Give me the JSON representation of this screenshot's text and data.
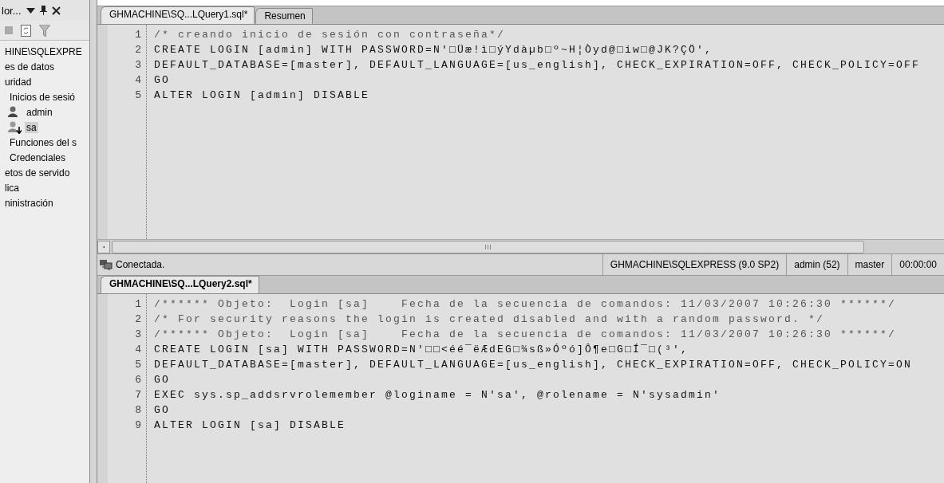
{
  "explorer": {
    "title": "lor...",
    "tree": [
      {
        "label": "HINE\\SQLEXPRE",
        "kind": "node",
        "selected": false,
        "children": [
          {
            "label": "es de datos",
            "kind": "node",
            "selected": false
          },
          {
            "label": "uridad",
            "kind": "node",
            "selected": false,
            "children": [
              {
                "label": "Inicios de sesió",
                "kind": "node",
                "selected": false,
                "children": [
                  {
                    "label": "admin",
                    "kind": "login",
                    "disabled": false,
                    "selected": false
                  },
                  {
                    "label": "sa",
                    "kind": "login",
                    "disabled": true,
                    "selected": true
                  }
                ]
              },
              {
                "label": "Funciones del s",
                "kind": "node",
                "selected": false
              },
              {
                "label": "Credenciales",
                "kind": "node",
                "selected": false
              }
            ]
          },
          {
            "label": "etos de servido",
            "kind": "node",
            "selected": false
          },
          {
            "label": "lica",
            "kind": "node",
            "selected": false
          },
          {
            "label": "ninistración",
            "kind": "node",
            "selected": false
          }
        ]
      }
    ]
  },
  "editors": [
    {
      "tabs": [
        {
          "label": "GHMACHINE\\SQ...LQuery1.sql*",
          "selected": true
        },
        {
          "label": "Resumen",
          "selected": false
        }
      ],
      "lines": [
        {
          "number": "1",
          "kind": "comment",
          "text": "/* creando inicio de sesión con contraseña*/"
        },
        {
          "number": "2",
          "kind": "code",
          "text": "CREATE LOGIN [admin] WITH PASSWORD=N'□Üæ!ì□ýYdàµb□º~H¦Òyd@□iw□@JK?ÇÖ',"
        },
        {
          "number": "3",
          "kind": "code",
          "text": "DEFAULT_DATABASE=[master], DEFAULT_LANGUAGE=[us_english], CHECK_EXPIRATION=OFF, CHECK_POLICY=OFF"
        },
        {
          "number": "4",
          "kind": "code",
          "text": "GO"
        },
        {
          "number": "5",
          "kind": "code",
          "text": "ALTER LOGIN [admin] DISABLE"
        }
      ],
      "status_bar": {
        "message": "Conectada.",
        "server": "GHMACHINE\\SQLEXPRESS (9.0 SP2)",
        "user": "admin (52)",
        "database": "master",
        "time": "00:00:00"
      }
    },
    {
      "tabs": [
        {
          "label": "GHMACHINE\\SQ...LQuery2.sql*",
          "selected": true
        }
      ],
      "lines": [
        {
          "number": "1",
          "kind": "comment",
          "text": "/****** Objeto:  Login [sa]    Fecha de la secuencia de comandos: 11/03/2007 10:26:30 ******/"
        },
        {
          "number": "2",
          "kind": "comment",
          "text": "/* For security reasons the login is created disabled and with a random password. */"
        },
        {
          "number": "3",
          "kind": "comment",
          "text": "/****** Objeto:  Login [sa]    Fecha de la secuencia de comandos: 11/03/2007 10:26:30 ******/"
        },
        {
          "number": "4",
          "kind": "code",
          "text": "CREATE LOGIN [sa] WITH PASSWORD=N'□□<éé¯ëÆdEG□¾sß»Óºó]Ô¶e□G□Í¯□(³',"
        },
        {
          "number": "5",
          "kind": "code",
          "text": "DEFAULT_DATABASE=[master], DEFAULT_LANGUAGE=[us_english], CHECK_EXPIRATION=OFF, CHECK_POLICY=ON"
        },
        {
          "number": "6",
          "kind": "code",
          "text": "GO"
        },
        {
          "number": "7",
          "kind": "code",
          "text": "EXEC sys.sp_addsrvrolemember @loginame = N'sa', @rolename = N'sysadmin'"
        },
        {
          "number": "8",
          "kind": "code",
          "text": "GO"
        },
        {
          "number": "9",
          "kind": "code",
          "text": "ALTER LOGIN [sa] DISABLE"
        }
      ]
    }
  ]
}
